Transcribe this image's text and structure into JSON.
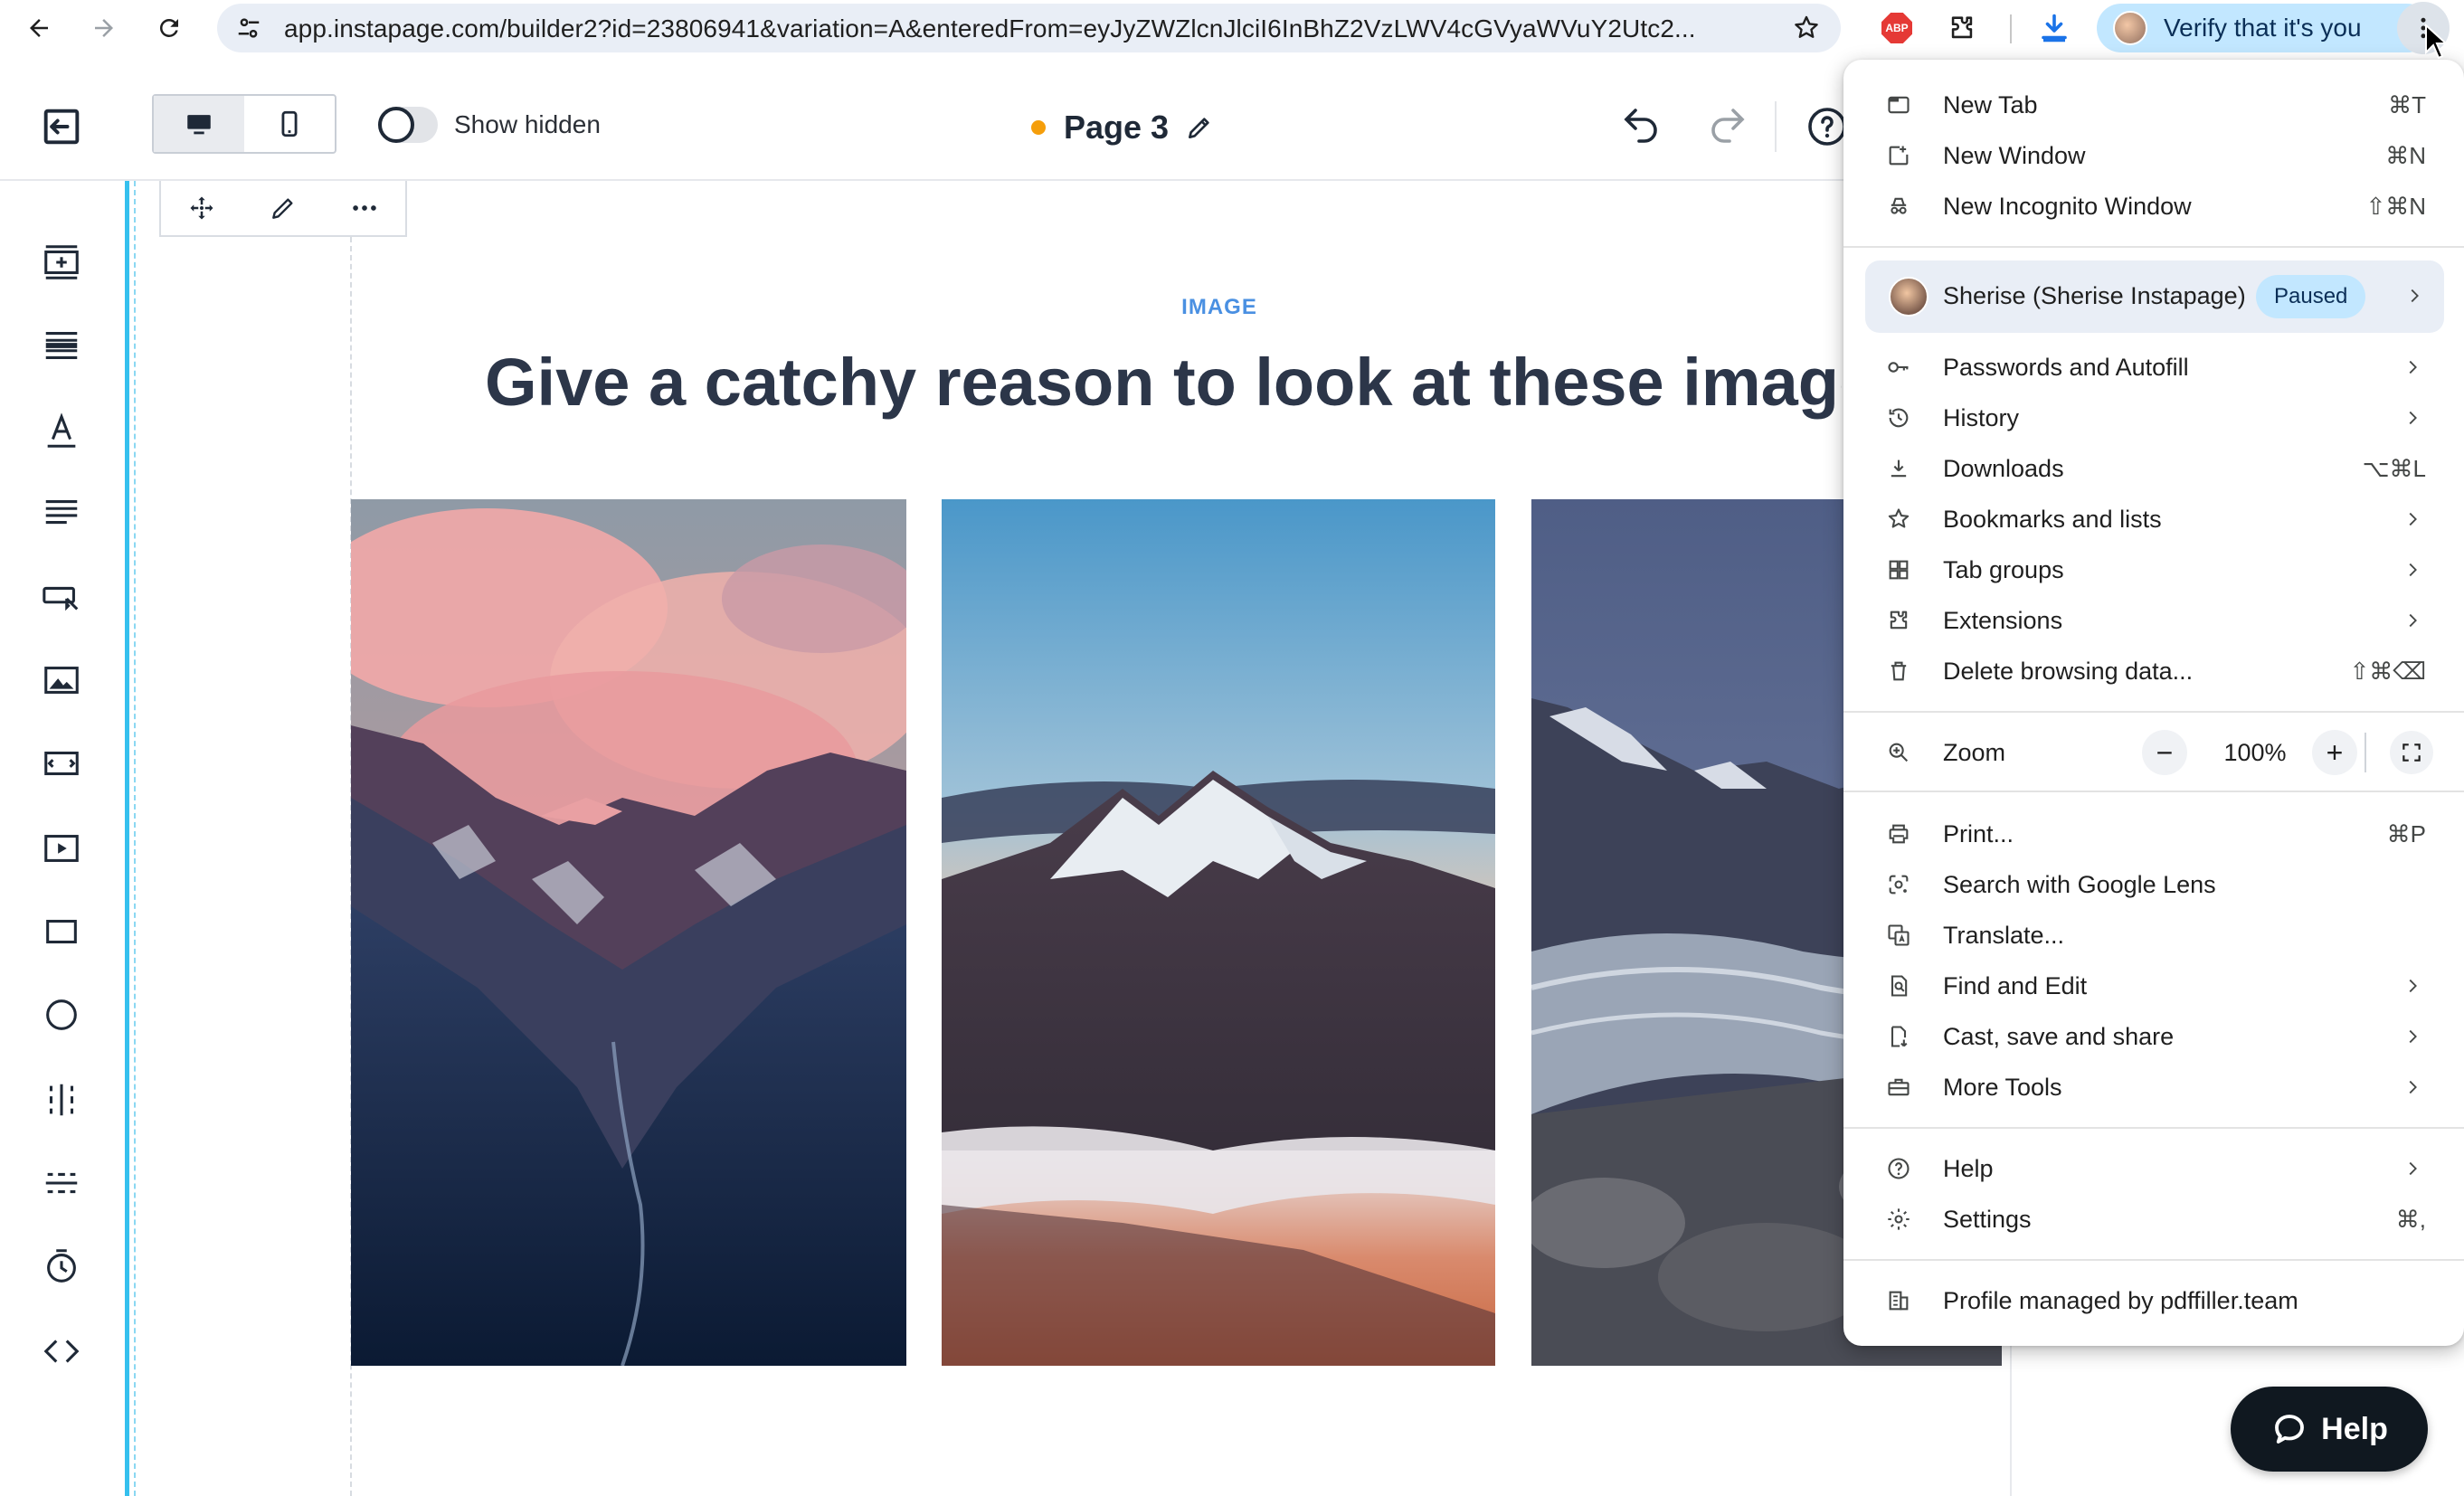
{
  "browser": {
    "url": "app.instapage.com/builder2?id=23806941&variation=A&enteredFrom=eyJyZWZlcnJlciI6InBhZ2VzLWV4cGVyaWVuY2Utc2...",
    "abp_label": "ABP",
    "verify_label": "Verify that it's you",
    "icons": [
      "back-icon",
      "forward-icon",
      "reload-icon",
      "site-settings-icon",
      "bookmark-star-icon",
      "adblock-plus-icon",
      "extensions-puzzle-icon",
      "download-icon",
      "more-vertical-icon"
    ]
  },
  "toolbar": {
    "show_hidden_label": "Show hidden",
    "page_title": "Page 3",
    "page_status_color": "#f59e0b"
  },
  "canvas": {
    "eyebrow": "IMAGE",
    "headline": "Give a catchy reason to look at these images",
    "photos": [
      "Mountain valley with pink clouds",
      "Snowy peak above clouds at sunset",
      "Glacier valley at dusk"
    ]
  },
  "help_button": {
    "label": "Help"
  },
  "menu": {
    "group1": [
      {
        "label": "New Tab",
        "shortcut": "⌘T",
        "icon": "new-tab-icon"
      },
      {
        "label": "New Window",
        "shortcut": "⌘N",
        "icon": "new-window-icon"
      },
      {
        "label": "New Incognito Window",
        "shortcut": "⇧⌘N",
        "icon": "incognito-icon"
      }
    ],
    "profile": {
      "name": "Sherise (Sherise Instapage)",
      "status": "Paused"
    },
    "group2": [
      {
        "label": "Passwords and Autofill",
        "shortcut": "",
        "icon": "key-icon",
        "submenu": true
      },
      {
        "label": "History",
        "shortcut": "",
        "icon": "history-icon",
        "submenu": true
      },
      {
        "label": "Downloads",
        "shortcut": "⌥⌘L",
        "icon": "download-icon",
        "submenu": false
      },
      {
        "label": "Bookmarks and lists",
        "shortcut": "",
        "icon": "star-icon",
        "submenu": true
      },
      {
        "label": "Tab groups",
        "shortcut": "",
        "icon": "tab-groups-icon",
        "submenu": true
      },
      {
        "label": "Extensions",
        "shortcut": "",
        "icon": "extensions-icon",
        "submenu": true
      },
      {
        "label": "Delete browsing data...",
        "shortcut": "⇧⌘⌫",
        "icon": "trash-icon",
        "submenu": false
      }
    ],
    "zoom": {
      "label": "Zoom",
      "value": "100%",
      "minus": "−",
      "plus": "+"
    },
    "group3": [
      {
        "label": "Print...",
        "shortcut": "⌘P",
        "icon": "print-icon",
        "submenu": false
      },
      {
        "label": "Search with Google Lens",
        "shortcut": "",
        "icon": "lens-icon",
        "submenu": false
      },
      {
        "label": "Translate...",
        "shortcut": "",
        "icon": "translate-icon",
        "submenu": false
      },
      {
        "label": "Find and Edit",
        "shortcut": "",
        "icon": "find-icon",
        "submenu": true
      },
      {
        "label": "Cast, save and share",
        "shortcut": "",
        "icon": "cast-icon",
        "submenu": true
      },
      {
        "label": "More Tools",
        "shortcut": "",
        "icon": "toolbox-icon",
        "submenu": true
      }
    ],
    "group4": [
      {
        "label": "Help",
        "shortcut": "",
        "icon": "help-icon",
        "submenu": true
      },
      {
        "label": "Settings",
        "shortcut": "⌘,",
        "icon": "settings-icon",
        "submenu": false
      }
    ],
    "managed": {
      "label": "Profile managed by pdffiller.team",
      "icon": "building-icon"
    }
  }
}
